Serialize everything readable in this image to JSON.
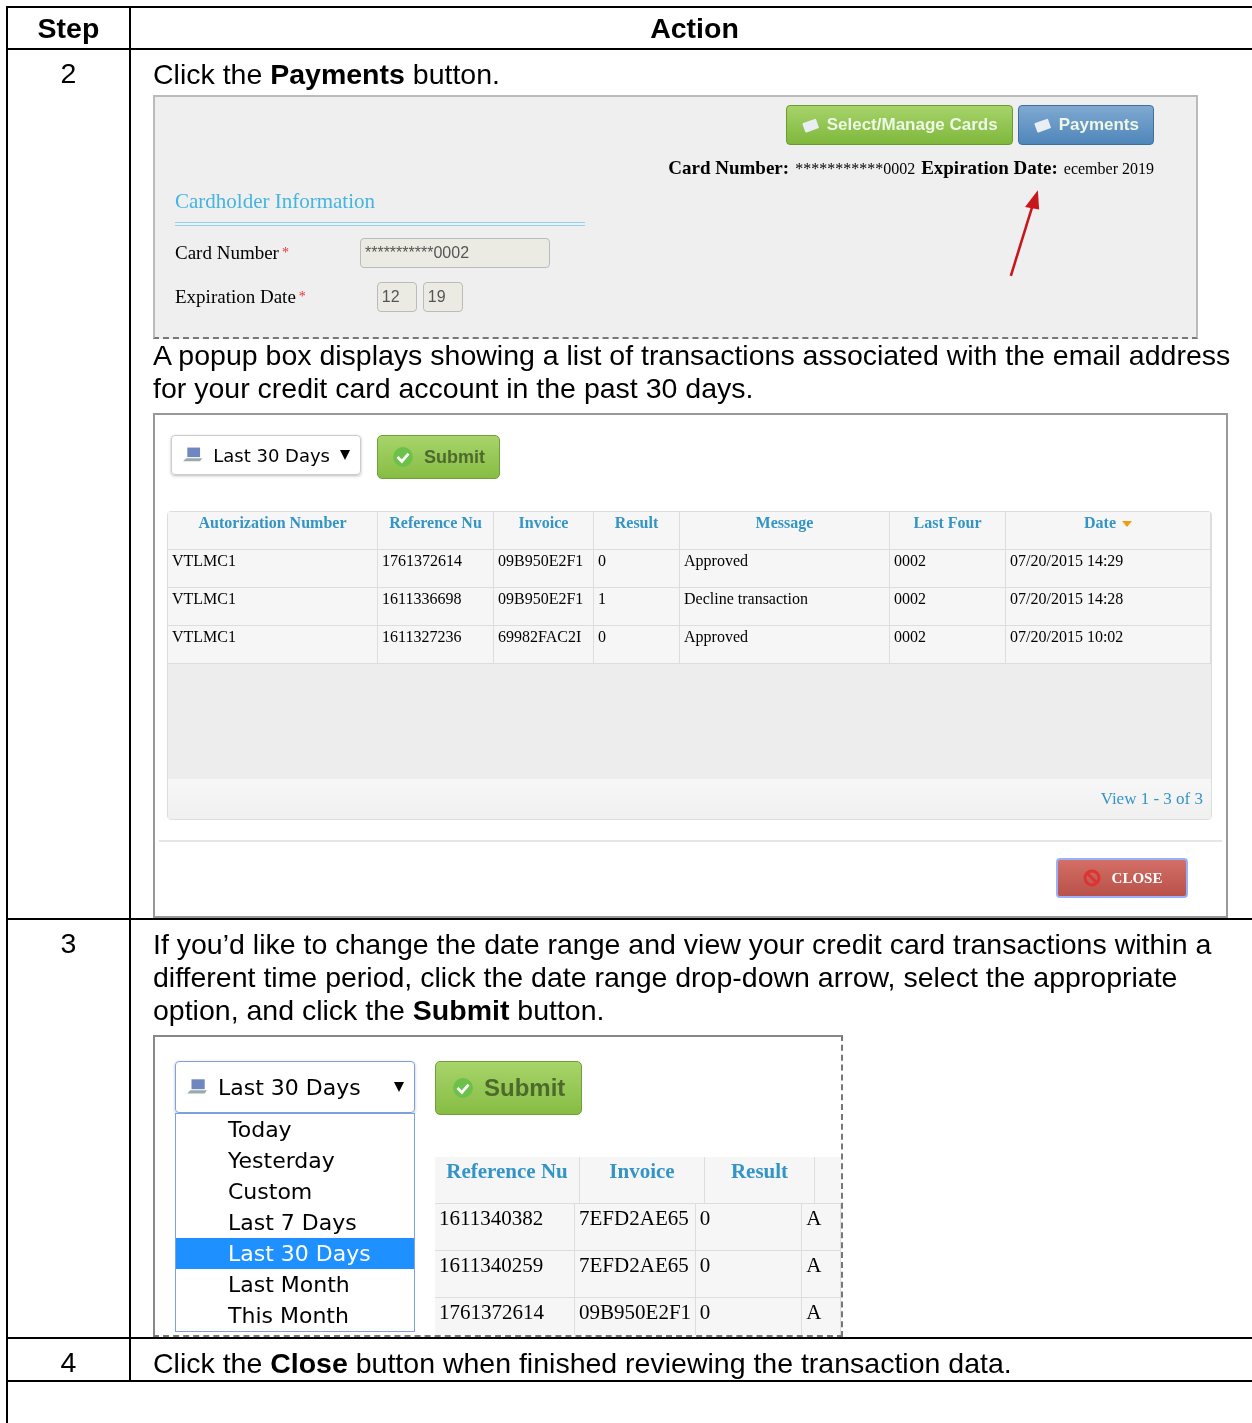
{
  "columns": [
    "Step",
    "Action"
  ],
  "steps": [
    {
      "step": "2",
      "instruction": "Click the **Payments** button.",
      "card_screen": {
        "buttons": [
          {
            "label": "Select/Manage Cards",
            "kind": "green"
          },
          {
            "label": "Payments",
            "kind": "blue"
          }
        ],
        "card_number_label": "Card Number:",
        "card_number": "***********0002",
        "expiration_label": "Expiration Date:",
        "expiration": "ecember 2019",
        "section_title": "Cardholder Information",
        "fields": [
          {
            "label": "Card Number",
            "marker": "*",
            "values": [
              "***********0002"
            ]
          },
          {
            "label": "Expiration Date",
            "marker": "*",
            "values": [
              "12",
              "19"
            ]
          }
        ]
      },
      "note": "A popup box displays showing a list of transactions associated with the email address for your credit card account in the past 30 days.",
      "popup": {
        "range": "Last 30 Days",
        "submit": "Submit",
        "columns": [
          "Autorization Number",
          "Reference Nu",
          "Invoice",
          "Result",
          "Message",
          "Last Four",
          "Date"
        ],
        "rows": [
          [
            "VTLMC1",
            "1761372614",
            "09B950E2F1",
            "0",
            "Approved",
            "0002",
            "07/20/2015 14:29"
          ],
          [
            "VTLMC1",
            "1611336698",
            "09B950E2F1",
            "1",
            "Decline transaction",
            "0002",
            "07/20/2015 14:28"
          ],
          [
            "VTLMC1",
            "1611327236",
            "69982FAC2I",
            "0",
            "Approved",
            "0002",
            "07/20/2015 10:02"
          ]
        ],
        "pager": "View 1 - 3 of 3",
        "close": "CLOSE"
      }
    },
    {
      "step": "3",
      "instruction": "If you’d like to change the date range and view your credit card transactions within a different time period, click the date range drop-down arrow, select the appropriate option, and click the **Submit** button.",
      "range_screen": {
        "range": "Last 30 Days",
        "submit": "Submit",
        "options": [
          {
            "label": "Today",
            "selected": false
          },
          {
            "label": "Yesterday",
            "selected": false
          },
          {
            "label": "Custom",
            "selected": false
          },
          {
            "label": "Last 7 Days",
            "selected": false
          },
          {
            "label": "Last 30 Days",
            "selected": true
          },
          {
            "label": "Last Month",
            "selected": false
          },
          {
            "label": "This Month",
            "selected": false
          }
        ],
        "columns": [
          "Reference Nu",
          "Invoice",
          "Result"
        ],
        "rows": [
          [
            "1611340382",
            "7EFD2AE65",
            "0",
            "A"
          ],
          [
            "1611340259",
            "7EFD2AE65",
            "0",
            "A"
          ],
          [
            "1761372614",
            "09B950E2F1",
            "0",
            "A"
          ]
        ]
      }
    },
    {
      "step": "4",
      "instruction": "Click the **Close** button when finished reviewing the transaction data."
    }
  ]
}
